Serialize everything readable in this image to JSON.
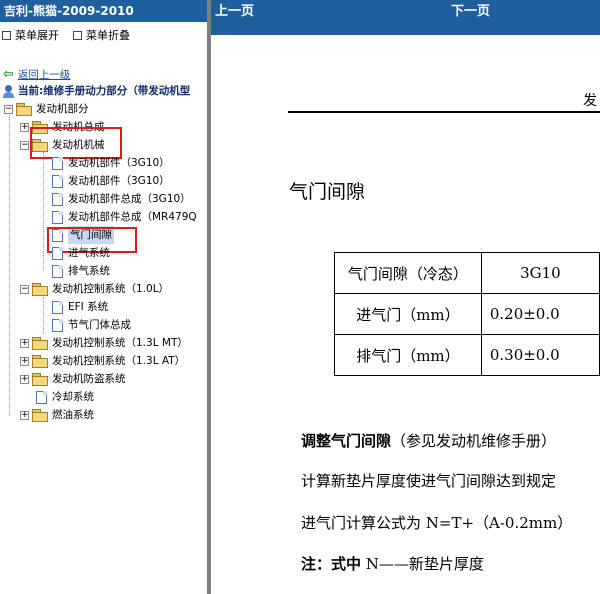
{
  "left_pane": {
    "title": "吉利-熊猫-2009-2010",
    "toolbar": {
      "expand_label": "菜单展开",
      "collapse_label": "菜单折叠"
    },
    "back_label": "返回上一级",
    "current_label": "当前:维修手册动力部分（带发动机型",
    "tree": [
      {
        "label": "发动机部分"
      },
      {
        "label": "发动机总成"
      },
      {
        "label": "发动机机械"
      },
      {
        "label": "发动机部件（3G10）"
      },
      {
        "label": "发动机部件（3G10）"
      },
      {
        "label": "发动机部件总成（3G10）"
      },
      {
        "label": "发动机部件总成（MR479Q"
      },
      {
        "label": "气门间隙"
      },
      {
        "label": "进气系统"
      },
      {
        "label": "排气系统"
      },
      {
        "label": "发动机控制系统（1.0L）"
      },
      {
        "label": "EFI 系统"
      },
      {
        "label": "节气门体总成"
      },
      {
        "label": "发动机控制系统（1.3L MT）"
      },
      {
        "label": "发动机控制系统（1.3L AT）"
      },
      {
        "label": "发动机防盗系统"
      },
      {
        "label": "冷却系统"
      },
      {
        "label": "燃油系统"
      }
    ]
  },
  "right_pane": {
    "nav": {
      "prev_label": "上一页",
      "next_label": "下一页"
    },
    "doc_header": "发",
    "section_title": "气门间隙",
    "table": {
      "header": [
        "气门间隙（冷态）",
        "3G10"
      ],
      "rows": [
        [
          "进气门（mm）",
          "0.20±0.0"
        ],
        [
          "排气门（mm）",
          "0.30±0.0"
        ]
      ]
    },
    "para1_bold": "调整气门间隙",
    "para1_rest": "（参见发动机维修手册）",
    "para2": "计算新垫片厚度使进气门间隙达到规定",
    "para3": "进气门计算公式为 N=T+（A-0.2mm）",
    "para4_bold": "注：式中",
    "para4_rest": " N——新垫片厚度"
  },
  "colors": {
    "header_blue": "#1f5f9e",
    "highlight_red": "#e21a1a",
    "divider_gray": "#7f7f7f"
  }
}
